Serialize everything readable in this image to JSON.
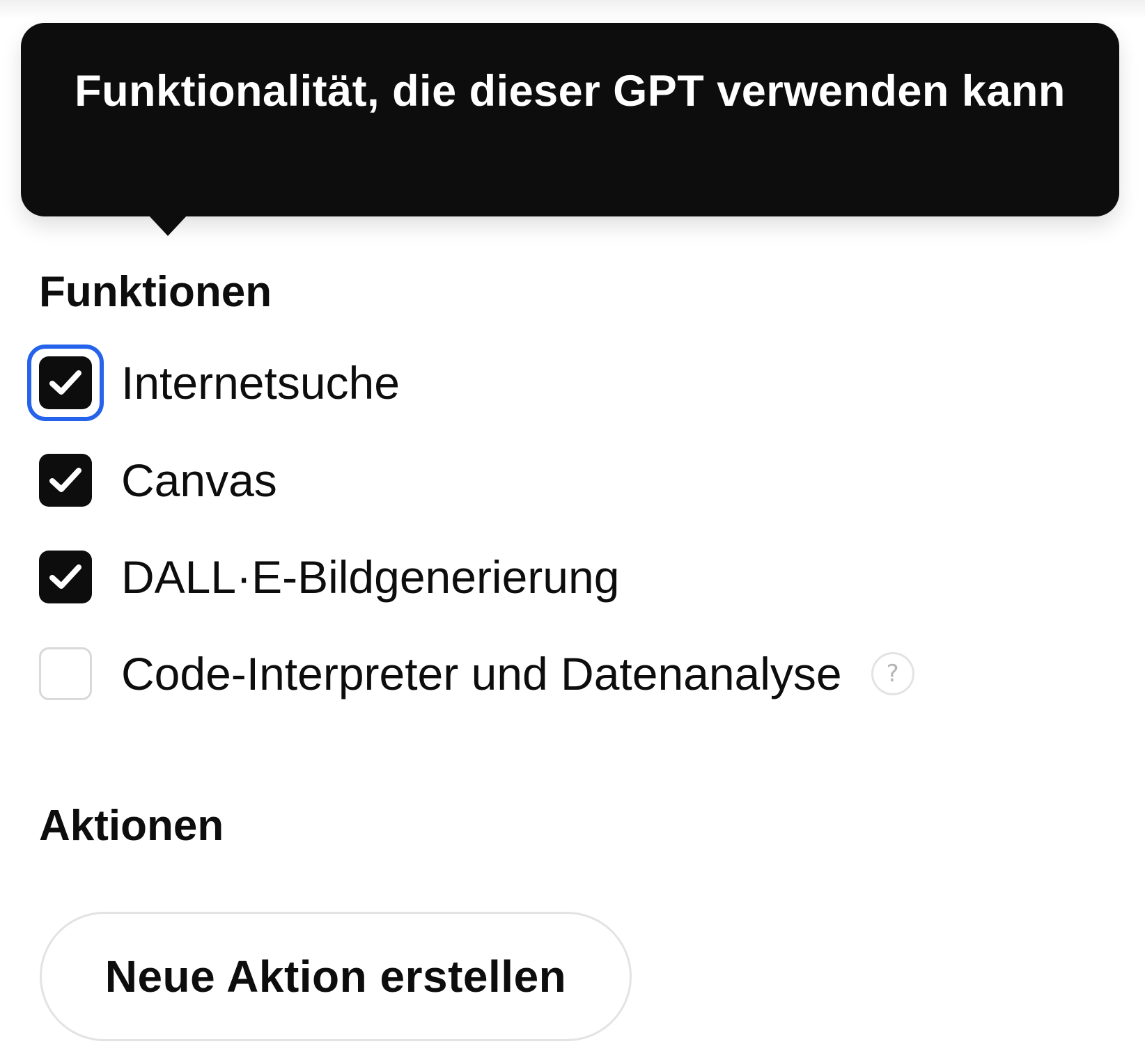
{
  "tooltip": {
    "text": "Funktionalität, die dieser GPT verwenden kann"
  },
  "capabilities": {
    "heading": "Funktionen",
    "items": [
      {
        "label": "Internetsuche",
        "checked": true,
        "focused": true
      },
      {
        "label": "Canvas",
        "checked": true
      },
      {
        "label": "DALL·E-Bildgenerierung",
        "checked": true
      },
      {
        "label": "Code-Interpreter und Datenanalyse",
        "checked": false,
        "help_icon": "question-mark-icon",
        "help_glyph": "?"
      }
    ]
  },
  "actions": {
    "heading": "Aktionen",
    "create_button_label": "Neue Aktion erstellen"
  },
  "colors": {
    "focus_ring": "#2563eb",
    "checkbox_checked": "#0d0d0d",
    "tooltip_background": "#0d0d0d"
  }
}
